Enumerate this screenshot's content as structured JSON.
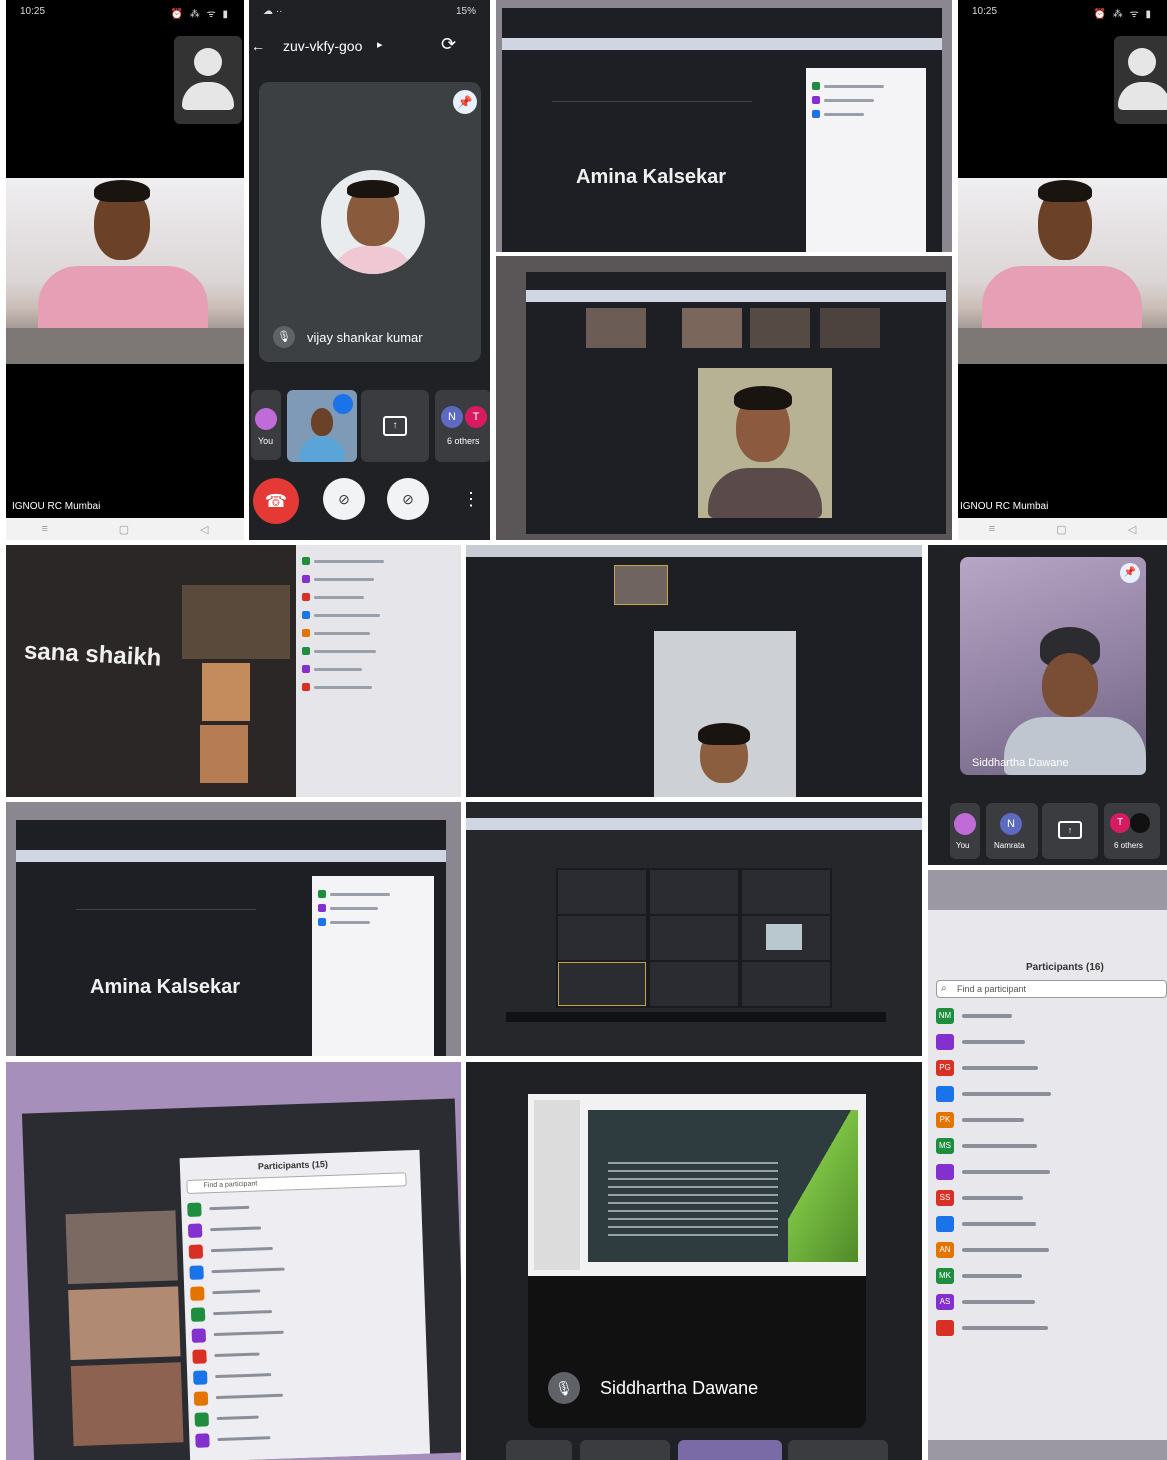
{
  "collage": {
    "tile1": {
      "status_time": "10:25",
      "status_icons": "☼ ⊕ ⊖",
      "status_right": "⏰ ⁂ ᯤ ▮",
      "caption": "IGNOU RC Mumbai"
    },
    "tile2": {
      "meeting_code": "zuv-vkfy-goo",
      "status_right": "15%",
      "participant_name": "vijay shankar kumar",
      "you_label": "You",
      "others_label": "6 others",
      "avatar_n": "N",
      "avatar_t": "T",
      "accent_red": "#e53935"
    },
    "tile3": {
      "name": "Amina Kalsekar"
    },
    "tile4": {},
    "tile5": {
      "status_time": "10:25",
      "status_icons": "☼ ⊕ ⊖",
      "status_right": "⏰ ⁂ ᯤ ▮",
      "caption": "IGNOU RC Mumbai"
    },
    "tile6": {
      "name": "sana shaikh"
    },
    "tile7": {},
    "tile8": {
      "participant_name": "Siddhartha Dawane",
      "you_label": "You",
      "n_label": "Namrata",
      "others_label": "6 others",
      "avatar_n": "N",
      "avatar_t": "T"
    },
    "tile9": {
      "name": "Amina Kalsekar"
    },
    "tile10": {},
    "tile11": {
      "panel_title": "Participants (16)",
      "search_placeholder": "Find a participant",
      "rows": [
        "NM",
        "",
        "PG",
        "",
        "PK",
        "MS",
        "",
        "SS",
        "",
        "AN",
        "MK",
        "AS",
        ""
      ]
    },
    "tile12": {
      "panel_title": "Participants (15)",
      "search_placeholder": "Find a participant"
    },
    "tile13": {
      "presenter_name": "Siddhartha Dawane"
    }
  },
  "colors": {
    "meet_dark": "#202124",
    "mic_off_grey": "#5f6368",
    "pink_shirt": "#e79fb6",
    "participant_chip_colors": [
      "#1e8e3e",
      "#8430ce",
      "#d93025",
      "#1a73e8",
      "#e37400"
    ]
  }
}
